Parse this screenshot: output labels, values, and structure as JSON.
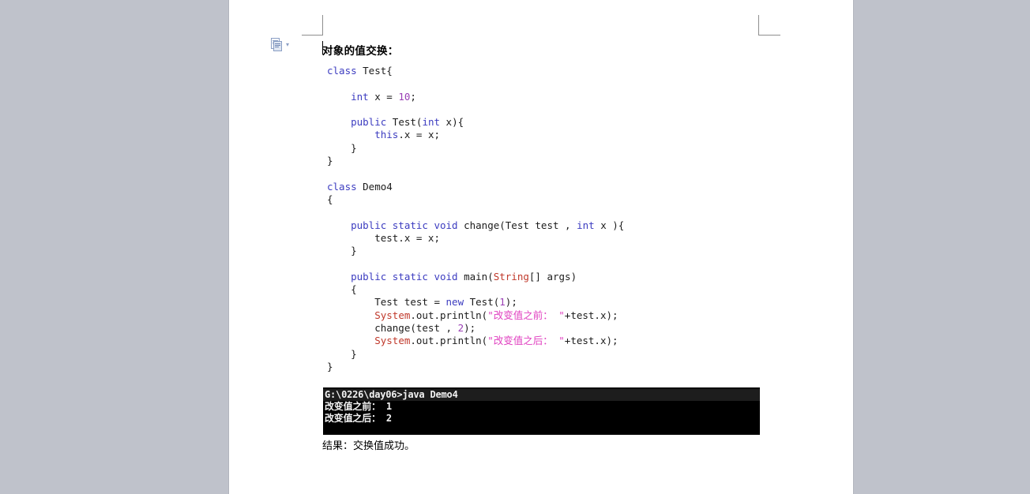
{
  "page": {
    "background_color": "#bfc2cb",
    "sheet_color": "#ffffff"
  },
  "smart_tag": {
    "icon": "paste-document-icon",
    "chevron": "▾"
  },
  "document": {
    "heading": "对象的值交换：",
    "result_note": "结果：交换值成功。",
    "code_lines": [
      [
        {
          "t": "class ",
          "c": "kw"
        },
        {
          "t": "Test{",
          "c": "plain"
        }
      ],
      [
        {
          "t": "",
          "c": "plain"
        }
      ],
      [
        {
          "t": "    int ",
          "c": "kw"
        },
        {
          "t": "x = ",
          "c": "plain"
        },
        {
          "t": "10",
          "c": "num"
        },
        {
          "t": ";",
          "c": "plain"
        }
      ],
      [
        {
          "t": "",
          "c": "plain"
        }
      ],
      [
        {
          "t": "    public ",
          "c": "kw"
        },
        {
          "t": "Test(",
          "c": "plain"
        },
        {
          "t": "int ",
          "c": "kw"
        },
        {
          "t": "x){",
          "c": "plain"
        }
      ],
      [
        {
          "t": "        this",
          "c": "kw"
        },
        {
          "t": ".x = x;",
          "c": "plain"
        }
      ],
      [
        {
          "t": "    }",
          "c": "plain"
        }
      ],
      [
        {
          "t": "}",
          "c": "plain"
        }
      ],
      [
        {
          "t": "",
          "c": "plain"
        }
      ],
      [
        {
          "t": "class ",
          "c": "kw"
        },
        {
          "t": "Demo4",
          "c": "plain"
        }
      ],
      [
        {
          "t": "{",
          "c": "plain"
        }
      ],
      [
        {
          "t": "",
          "c": "plain"
        }
      ],
      [
        {
          "t": "    public static void ",
          "c": "kw"
        },
        {
          "t": "change(Test test , ",
          "c": "plain"
        },
        {
          "t": "int ",
          "c": "kw"
        },
        {
          "t": "x ){",
          "c": "plain"
        }
      ],
      [
        {
          "t": "        test.x = x;",
          "c": "plain"
        }
      ],
      [
        {
          "t": "    }",
          "c": "plain"
        }
      ],
      [
        {
          "t": "",
          "c": "plain"
        }
      ],
      [
        {
          "t": "    public static void ",
          "c": "kw"
        },
        {
          "t": "main(",
          "c": "plain"
        },
        {
          "t": "String",
          "c": "type-r"
        },
        {
          "t": "[] args)",
          "c": "plain"
        }
      ],
      [
        {
          "t": "    {",
          "c": "plain"
        }
      ],
      [
        {
          "t": "        Test test = ",
          "c": "plain"
        },
        {
          "t": "new ",
          "c": "kw"
        },
        {
          "t": "Test(",
          "c": "plain"
        },
        {
          "t": "1",
          "c": "num"
        },
        {
          "t": ");",
          "c": "plain"
        }
      ],
      [
        {
          "t": "        ",
          "c": "plain"
        },
        {
          "t": "System",
          "c": "type-r"
        },
        {
          "t": ".out.println(",
          "c": "plain"
        },
        {
          "t": "\"改变值之前： \"",
          "c": "str"
        },
        {
          "t": "+test.x);",
          "c": "plain"
        }
      ],
      [
        {
          "t": "        change(test , ",
          "c": "plain"
        },
        {
          "t": "2",
          "c": "num"
        },
        {
          "t": ");",
          "c": "plain"
        }
      ],
      [
        {
          "t": "        ",
          "c": "plain"
        },
        {
          "t": "System",
          "c": "type-r"
        },
        {
          "t": ".out.println(",
          "c": "plain"
        },
        {
          "t": "\"改变值之后： \"",
          "c": "str"
        },
        {
          "t": "+test.x);",
          "c": "plain"
        }
      ],
      [
        {
          "t": "    }",
          "c": "plain"
        }
      ],
      [
        {
          "t": "}",
          "c": "plain"
        }
      ]
    ]
  },
  "console": {
    "background_color": "#000000",
    "text_color": "#f2f2f2",
    "lines": [
      {
        "text": "G:\\0226\\day06>java Demo4",
        "selected": true
      },
      {
        "text": "改变值之前： 1",
        "selected": false
      },
      {
        "text": "改变值之后： 2",
        "selected": false
      }
    ]
  },
  "syntax_colors": {
    "keyword": "#3c3cc0",
    "number": "#9a3fb5",
    "type": "#c0392b",
    "string": "#e040c0",
    "plain": "#1c1c1c"
  }
}
